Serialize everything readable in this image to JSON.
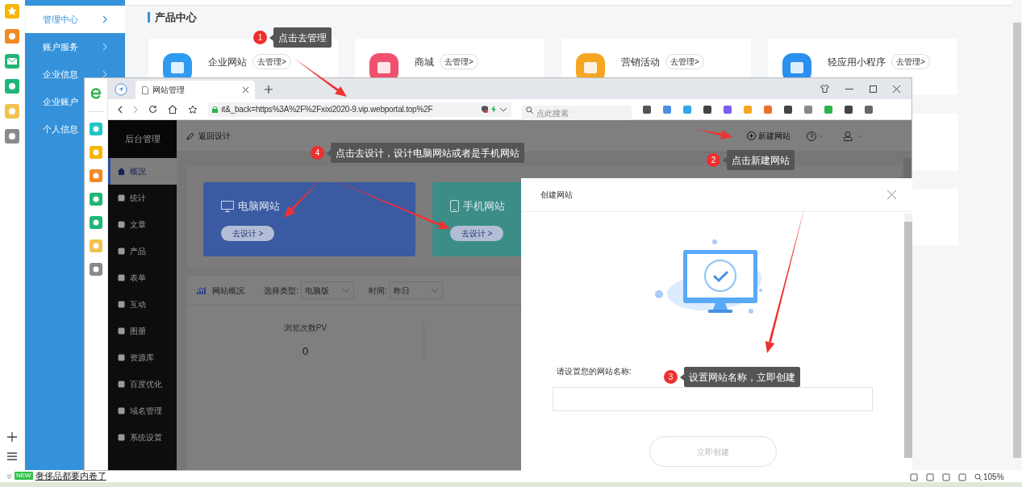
{
  "sidebar": {
    "items": [
      {
        "label": "管理中心",
        "selected": true
      },
      {
        "label": "账户服务",
        "selected": false
      },
      {
        "label": "企业信息",
        "selected": false
      },
      {
        "label": "企业账户",
        "selected": false
      },
      {
        "label": "个人信息",
        "selected": false
      }
    ]
  },
  "section_title": "产品中心",
  "product_cards": [
    {
      "name": "企业网站",
      "action": "去管理>",
      "color": "#2f9bf0"
    },
    {
      "name": "商城",
      "action": "去管理>",
      "color": "#f0506e"
    },
    {
      "name": "营销活动",
      "action": "去管理>",
      "color": "#f5a623"
    },
    {
      "name": "轻应用小程序",
      "action": "去管理>",
      "color": "#2b8ff0"
    }
  ],
  "news_ticker": {
    "badge": "NEW",
    "text": "奢侈品都要内卷了"
  },
  "status_bar": {
    "zoom": "105%"
  },
  "browser": {
    "tab": {
      "title": "网站管理"
    },
    "url": "ıt&_back=https%3A%2F%2Fxixi2020-9.vip.webportal.top%2F",
    "search": {
      "placeholder": "点此搜索"
    },
    "admin": {
      "brand": "后台管理",
      "back_link": "返回设计",
      "new_site": "新建网站",
      "menu": [
        {
          "label": "概况",
          "selected": true
        },
        {
          "label": "统计",
          "selected": false
        },
        {
          "label": "文章",
          "selected": false
        },
        {
          "label": "产品",
          "selected": false
        },
        {
          "label": "表单",
          "selected": false
        },
        {
          "label": "互动",
          "selected": false
        },
        {
          "label": "图册",
          "selected": false
        },
        {
          "label": "资源库",
          "selected": false
        },
        {
          "label": "百度优化",
          "selected": false
        },
        {
          "label": "域名管理",
          "selected": false
        },
        {
          "label": "系统设置",
          "selected": false
        }
      ],
      "design_cards": [
        {
          "kind": "desktop",
          "title": "电脑网站",
          "action": "去设计 >"
        },
        {
          "kind": "mobile",
          "title": "手机网站",
          "action": "去设计 >"
        }
      ],
      "overview": {
        "title": "网站概况",
        "type_label": "选择类型:",
        "type_value": "电脑版",
        "time_label": "时间:",
        "time_value": "昨日",
        "metric_label": "浏览次数PV",
        "metric_value": "0"
      }
    },
    "dialog": {
      "title": "创建网站",
      "field_label": "请设置您的网站名称:",
      "submit": "立即创建",
      "submit_disabled": true
    }
  },
  "callouts": [
    {
      "number": "1",
      "text": "点击去管理"
    },
    {
      "number": "2",
      "text": "点击新建网站"
    },
    {
      "number": "3",
      "text": "设置网站名称，立即创建"
    },
    {
      "number": "4",
      "text": "点击去设计，设计电脑网站或者是手机网站"
    }
  ]
}
